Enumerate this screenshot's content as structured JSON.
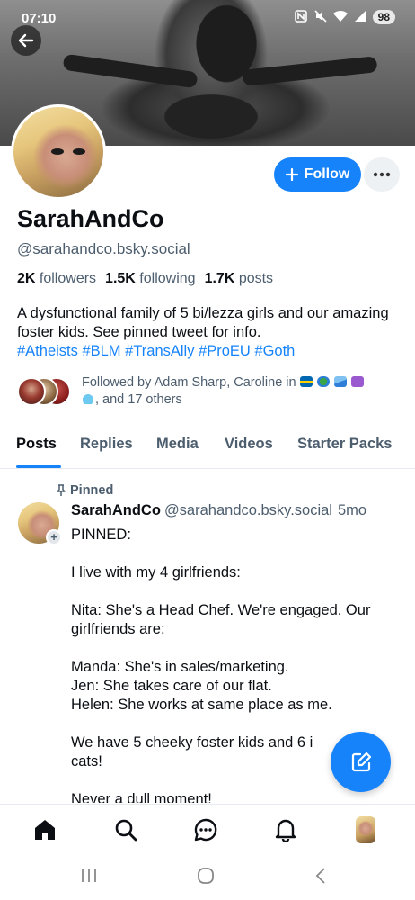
{
  "status_bar": {
    "time": "07:10",
    "battery": "98"
  },
  "profile": {
    "display_name": "SarahAndCo",
    "handle": "@sarahandco.bsky.social",
    "follow_label": "Follow",
    "stats": {
      "followers_count": "2K",
      "followers_label": "followers",
      "following_count": "1.5K",
      "following_label": "following",
      "posts_count": "1.7K",
      "posts_label": "posts"
    },
    "bio_text": "A dysfunctional family of 5 bi/lezza girls and our amazing foster kids. See pinned tweet for info.",
    "bio_tags": "#Atheists #BLM #TransAlly #ProEU #Goth",
    "followed_by_line1": "Followed by Adam Sharp, Caroline in",
    "followed_by_line2": ", and 17 others"
  },
  "tabs": [
    "Posts",
    "Replies",
    "Media",
    "Videos",
    "Starter Packs"
  ],
  "active_tab": "Posts",
  "post": {
    "pinned_label": "Pinned",
    "author_name": "SarahAndCo",
    "author_handle": "@sarahandco.bsky.social",
    "time": "5mo",
    "body": "PINNED:\n\nI live with my 4 girlfriends:\n\nNita: She's a Head Chef. We're engaged. Our girlfriends are:\n\nManda: She's in sales/marketing.\nJen: She takes care of our flat.\nHelen: She works at same place as me.\n\nWe have 5 cheeky foster kids and 6 i\ncats!\n\nNever a dull moment!"
  },
  "bottom_nav": [
    "home-icon",
    "search-icon",
    "chat-icon",
    "notifications-icon",
    "profile-avatar"
  ],
  "colors": {
    "accent": "#1683fb",
    "muted": "#4c5d6e",
    "text": "#0b0f14"
  }
}
